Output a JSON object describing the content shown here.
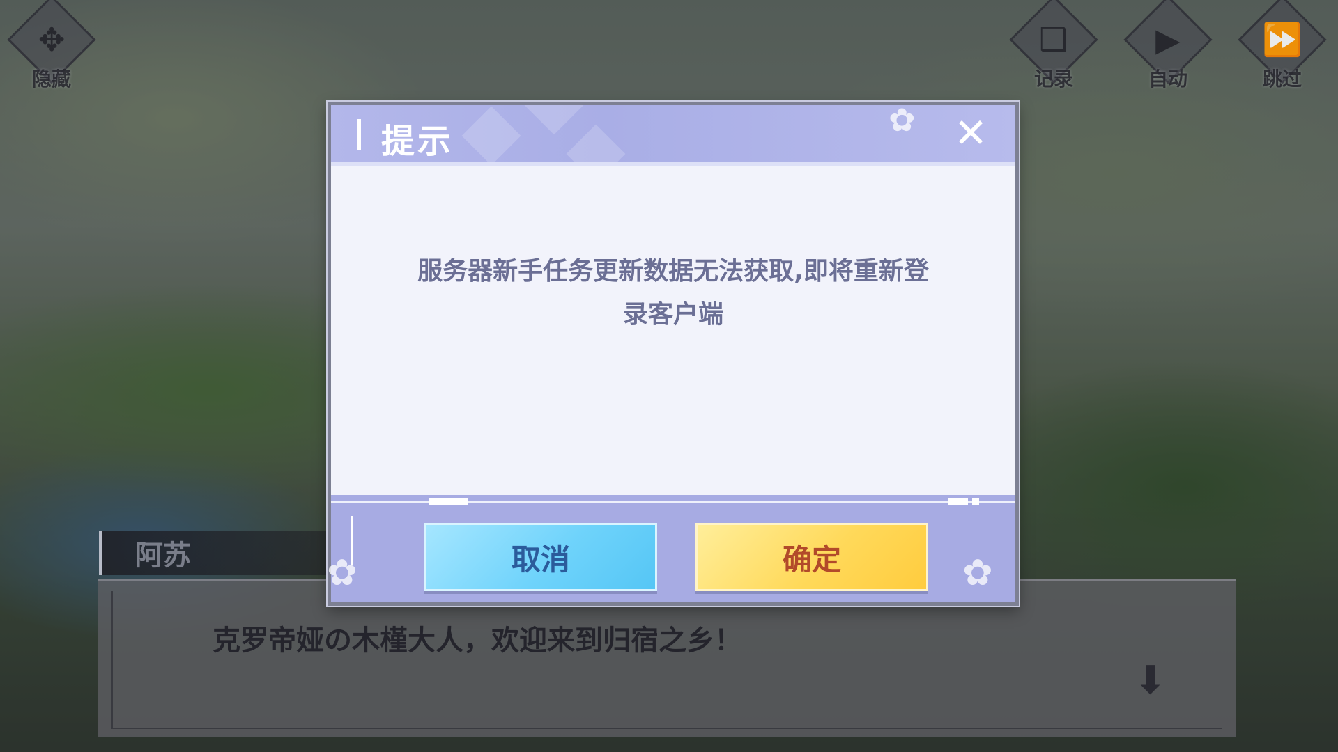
{
  "top_bar": {
    "hide_label": "隐藏",
    "log_label": "记录",
    "auto_label": "自动",
    "skip_label": "跳过"
  },
  "icons": {
    "hide": "hide-icon",
    "log": "chat-log-icon",
    "auto": "play-icon",
    "skip": "fast-forward-icon",
    "close": "close-icon",
    "advance": "advance-arrow-icon"
  },
  "dialogue": {
    "speaker": "阿苏",
    "text": "克罗帝娅の木槿大人，欢迎来到归宿之乡！"
  },
  "modal": {
    "title": "提示",
    "message": "服务器新手任务更新数据无法获取,即将重新登录客户端",
    "cancel_label": "取消",
    "confirm_label": "确定"
  },
  "colors": {
    "modal_header": "#a9aee6",
    "modal_body": "#f2f3fb",
    "cancel_button": "#6fd3fb",
    "confirm_button": "#ffd95a",
    "message_text": "#6b6f95"
  }
}
